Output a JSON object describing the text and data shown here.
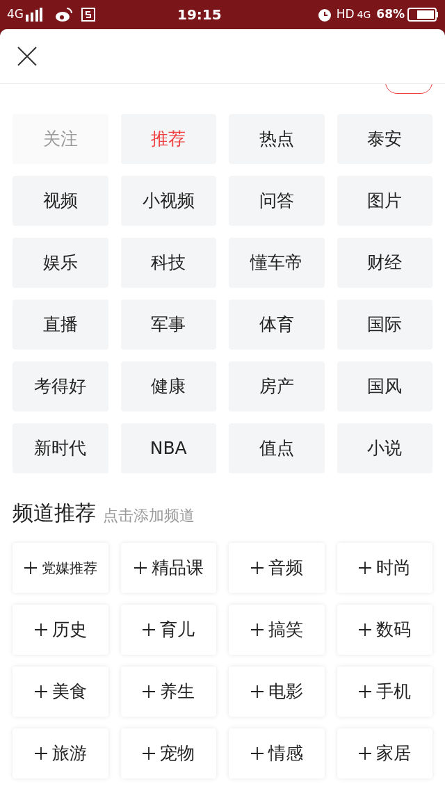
{
  "status_bar": {
    "network": "4G",
    "time": "19:15",
    "hd": "HD",
    "data_network": "4G",
    "battery": "68%"
  },
  "my_channels": {
    "items": [
      {
        "label": "关注",
        "selected": false,
        "disabled": true
      },
      {
        "label": "推荐",
        "selected": true,
        "disabled": false
      },
      {
        "label": "热点",
        "selected": false,
        "disabled": false
      },
      {
        "label": "泰安",
        "selected": false,
        "disabled": false
      },
      {
        "label": "视频",
        "selected": false,
        "disabled": false
      },
      {
        "label": "小视频",
        "selected": false,
        "disabled": false
      },
      {
        "label": "问答",
        "selected": false,
        "disabled": false
      },
      {
        "label": "图片",
        "selected": false,
        "disabled": false
      },
      {
        "label": "娱乐",
        "selected": false,
        "disabled": false
      },
      {
        "label": "科技",
        "selected": false,
        "disabled": false
      },
      {
        "label": "懂车帝",
        "selected": false,
        "disabled": false
      },
      {
        "label": "财经",
        "selected": false,
        "disabled": false
      },
      {
        "label": "直播",
        "selected": false,
        "disabled": false
      },
      {
        "label": "军事",
        "selected": false,
        "disabled": false
      },
      {
        "label": "体育",
        "selected": false,
        "disabled": false
      },
      {
        "label": "国际",
        "selected": false,
        "disabled": false
      },
      {
        "label": "考得好",
        "selected": false,
        "disabled": false
      },
      {
        "label": "健康",
        "selected": false,
        "disabled": false
      },
      {
        "label": "房产",
        "selected": false,
        "disabled": false
      },
      {
        "label": "国风",
        "selected": false,
        "disabled": false
      },
      {
        "label": "新时代",
        "selected": false,
        "disabled": false
      },
      {
        "label": "NBA",
        "selected": false,
        "disabled": false
      },
      {
        "label": "值点",
        "selected": false,
        "disabled": false
      },
      {
        "label": "小说",
        "selected": false,
        "disabled": false
      }
    ]
  },
  "recommended": {
    "title": "频道推荐",
    "hint": "点击添加频道",
    "items": [
      "党媒推荐",
      "精品课",
      "音频",
      "时尚",
      "历史",
      "育儿",
      "搞笑",
      "数码",
      "美食",
      "养生",
      "电影",
      "手机",
      "旅游",
      "宠物",
      "情感",
      "家居"
    ]
  }
}
